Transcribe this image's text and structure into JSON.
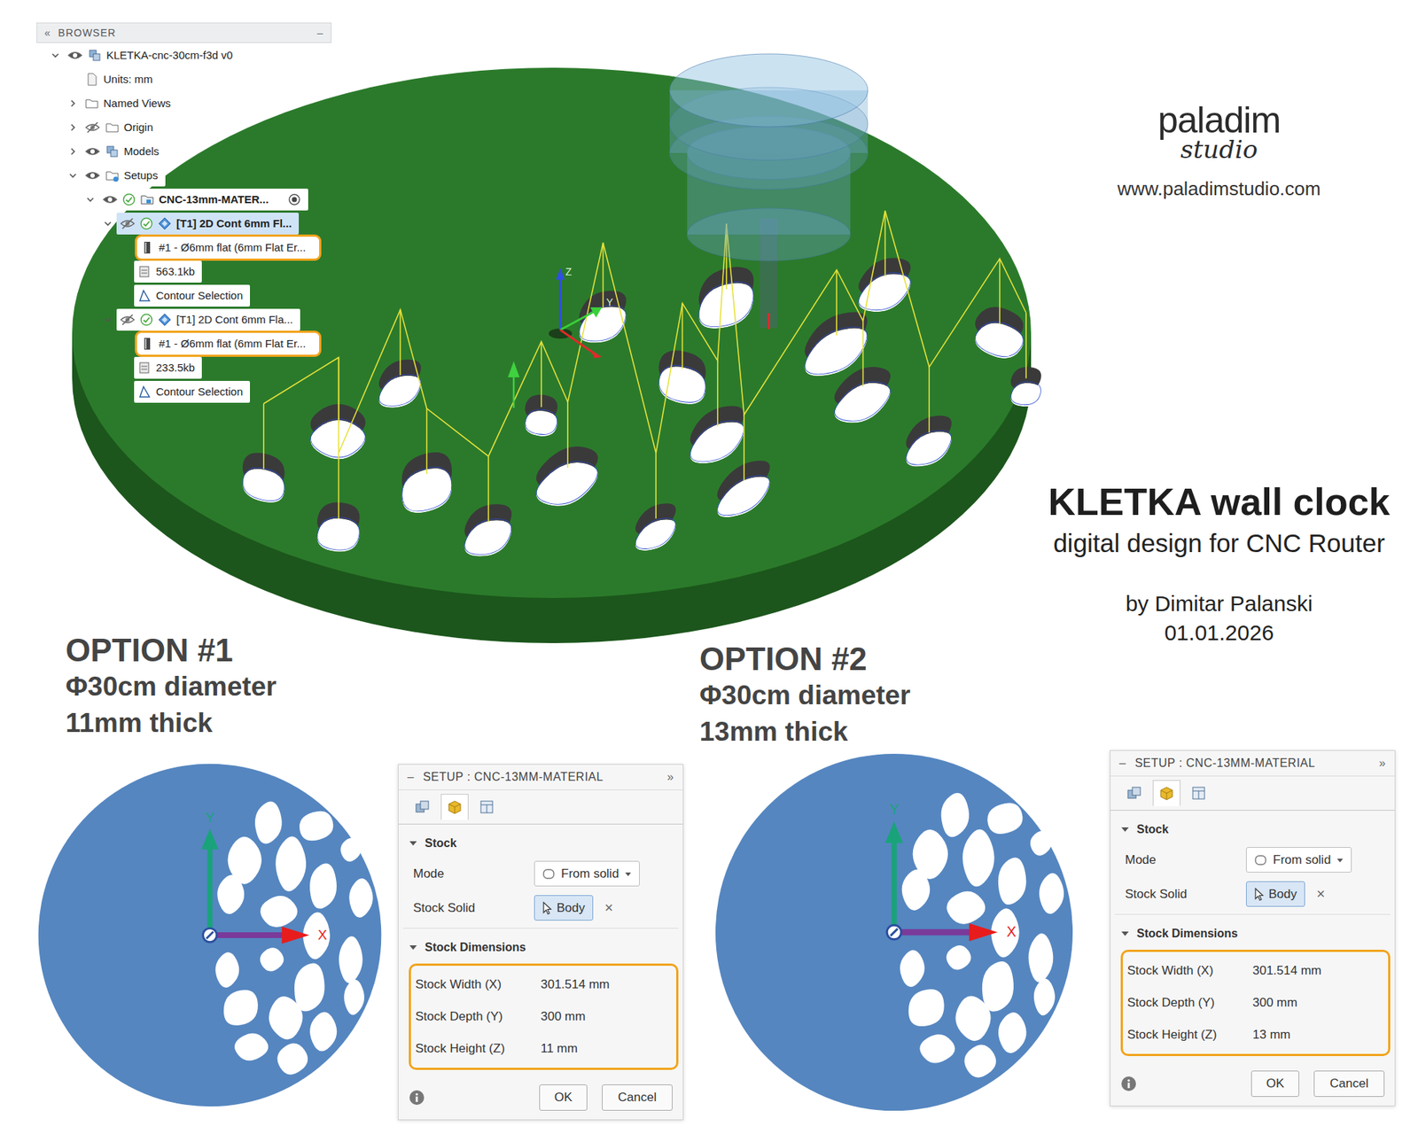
{
  "browser": {
    "title": "BROWSER",
    "collapse": "«",
    "minimize": "–",
    "rows": [
      {
        "label": "KLETKA-cnc-30cm-f3d v0",
        "kind": "component",
        "level": 0,
        "expandable": true,
        "expanded": true,
        "has_eye": true,
        "visible": true,
        "has_check": false,
        "checked": false,
        "active": false,
        "selected": false,
        "highlighted": false,
        "has_radio": false
      },
      {
        "label": "Units: mm",
        "kind": "units",
        "level": 1,
        "expandable": false,
        "expanded": false,
        "has_eye": false,
        "visible": false,
        "has_check": false,
        "checked": false,
        "active": false,
        "selected": false,
        "highlighted": false,
        "has_radio": false
      },
      {
        "label": "Named Views",
        "kind": "folder",
        "level": 1,
        "expandable": true,
        "expanded": false,
        "has_eye": false,
        "visible": false,
        "has_check": false,
        "checked": false,
        "active": false,
        "selected": false,
        "highlighted": false,
        "has_radio": false
      },
      {
        "label": "Origin",
        "kind": "folder",
        "level": 1,
        "expandable": true,
        "expanded": false,
        "has_eye": true,
        "visible": false,
        "has_check": false,
        "checked": false,
        "active": false,
        "selected": false,
        "highlighted": false,
        "has_radio": false
      },
      {
        "label": "Models",
        "kind": "component",
        "level": 1,
        "expandable": true,
        "expanded": false,
        "has_eye": true,
        "visible": true,
        "has_check": false,
        "checked": false,
        "active": false,
        "selected": false,
        "highlighted": false,
        "has_radio": false
      },
      {
        "label": "Setups",
        "kind": "setups",
        "level": 1,
        "expandable": true,
        "expanded": true,
        "has_eye": true,
        "visible": true,
        "has_check": false,
        "checked": false,
        "active": false,
        "selected": false,
        "highlighted": false,
        "has_radio": false
      },
      {
        "label": "CNC-13mm-MATER...",
        "kind": "setup",
        "level": 2,
        "expandable": true,
        "expanded": true,
        "has_eye": true,
        "visible": true,
        "has_check": true,
        "checked": true,
        "active": true,
        "selected": false,
        "highlighted": false,
        "has_radio": true
      },
      {
        "label": "[T1] 2D Cont 6mm Fl...",
        "kind": "operation",
        "level": 3,
        "expandable": true,
        "expanded": true,
        "has_eye": true,
        "visible": false,
        "has_check": true,
        "checked": true,
        "active": true,
        "selected": true,
        "highlighted": false,
        "has_radio": false
      },
      {
        "label": "#1 - Ø6mm flat (6mm Flat Er...",
        "kind": "tool",
        "level": 4,
        "expandable": false,
        "expanded": false,
        "has_eye": false,
        "visible": false,
        "has_check": false,
        "checked": false,
        "active": false,
        "selected": false,
        "highlighted": true,
        "has_radio": false
      },
      {
        "label": "563.1kb",
        "kind": "file",
        "level": 4,
        "expandable": false,
        "expanded": false,
        "has_eye": false,
        "visible": false,
        "has_check": false,
        "checked": false,
        "active": false,
        "selected": false,
        "highlighted": false,
        "has_radio": false
      },
      {
        "label": "Contour Selection",
        "kind": "contour",
        "level": 4,
        "expandable": false,
        "expanded": false,
        "has_eye": false,
        "visible": false,
        "has_check": false,
        "checked": false,
        "active": false,
        "selected": false,
        "highlighted": false,
        "has_radio": false
      },
      {
        "label": "[T1] 2D Cont 6mm Fla...",
        "kind": "operation",
        "level": 3,
        "expandable": true,
        "expanded": true,
        "has_eye": true,
        "visible": false,
        "has_check": true,
        "checked": true,
        "active": false,
        "selected": false,
        "highlighted": false,
        "has_radio": false
      },
      {
        "label": "#1 - Ø6mm flat (6mm Flat Er...",
        "kind": "tool",
        "level": 4,
        "expandable": false,
        "expanded": false,
        "has_eye": false,
        "visible": false,
        "has_check": false,
        "checked": false,
        "active": false,
        "selected": false,
        "highlighted": true,
        "has_radio": false
      },
      {
        "label": "233.5kb",
        "kind": "file",
        "level": 4,
        "expandable": false,
        "expanded": false,
        "has_eye": false,
        "visible": false,
        "has_check": false,
        "checked": false,
        "active": false,
        "selected": false,
        "highlighted": false,
        "has_radio": false
      },
      {
        "label": "Contour Selection",
        "kind": "contour",
        "level": 4,
        "expandable": false,
        "expanded": false,
        "has_eye": false,
        "visible": false,
        "has_check": false,
        "checked": false,
        "active": false,
        "selected": false,
        "highlighted": false,
        "has_radio": false
      }
    ]
  },
  "viewport": {
    "triad": [
      "Z",
      "Y"
    ]
  },
  "brand": {
    "name": "paladim",
    "sub": "studio",
    "url": "www.paladimstudio.com"
  },
  "title": {
    "heading": "KLETKA wall clock",
    "subheading": "digital design for CNC Router",
    "author": "by Dimitar Palanski",
    "date": "01.01.2026"
  },
  "options": [
    {
      "title": "OPTION #1",
      "diameter": "Φ30cm diameter",
      "thickness": "11mm thick",
      "axes": {
        "x": "X",
        "y": "Y"
      },
      "setup": {
        "collapse": "–",
        "title": "SETUP : CNC-13MM-MATERIAL",
        "expand": "»",
        "tabs": [
          {
            "selected": false
          },
          {
            "selected": true
          },
          {
            "selected": false
          }
        ],
        "section": "Stock",
        "mode_label": "Mode",
        "mode_value": "From solid",
        "solid_label": "Stock Solid",
        "solid_value": "Body",
        "clear": "×",
        "dims_title": "Stock Dimensions",
        "dims_highlighted": true,
        "dims": [
          {
            "label": "Stock Width (X)",
            "value": "301.514 mm"
          },
          {
            "label": "Stock Depth (Y)",
            "value": "300 mm"
          },
          {
            "label": "Stock Height (Z)",
            "value": "11 mm"
          }
        ],
        "buttons": [
          "OK",
          "Cancel"
        ]
      }
    },
    {
      "title": "OPTION #2",
      "diameter": "Φ30cm diameter",
      "thickness": "13mm thick",
      "axes": {
        "x": "X",
        "y": "Y"
      },
      "setup": {
        "collapse": "–",
        "title": "SETUP : CNC-13MM-MATERIAL",
        "expand": "»",
        "tabs": [
          {
            "selected": false
          },
          {
            "selected": true
          },
          {
            "selected": false
          }
        ],
        "section": "Stock",
        "mode_label": "Mode",
        "mode_value": "From solid",
        "solid_label": "Stock Solid",
        "solid_value": "Body",
        "clear": "×",
        "dims_title": "Stock Dimensions",
        "dims_highlighted": true,
        "dims": [
          {
            "label": "Stock Width (X)",
            "value": "301.514 mm"
          },
          {
            "label": "Stock Depth (Y)",
            "value": "300 mm"
          },
          {
            "label": "Stock Height (Z)",
            "value": "13 mm"
          }
        ],
        "buttons": [
          "OK",
          "Cancel"
        ]
      }
    }
  ]
}
